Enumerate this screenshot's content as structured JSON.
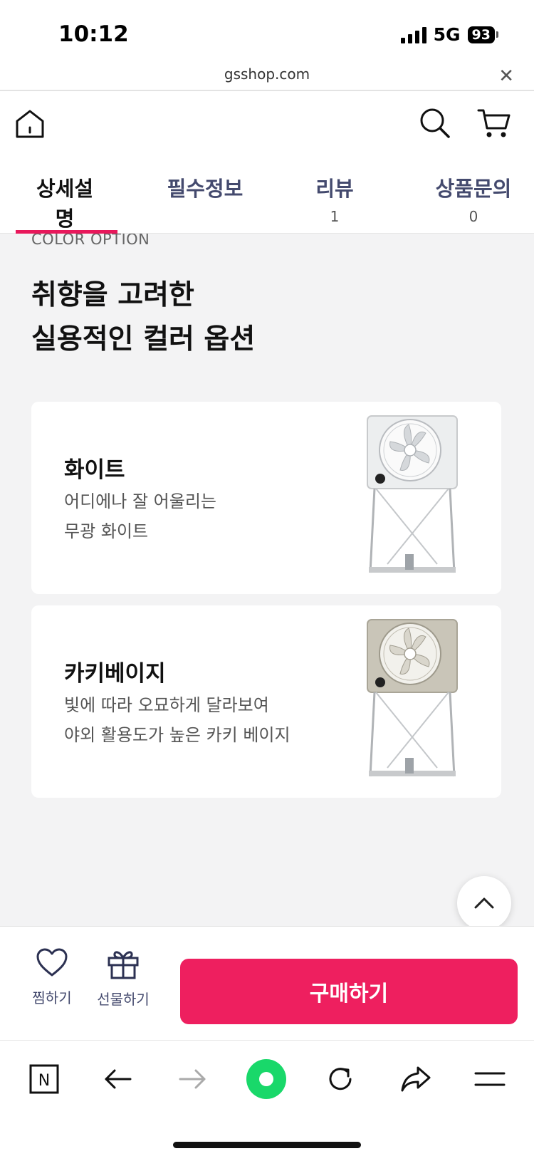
{
  "status_bar": {
    "time": "10:12",
    "network": "5G",
    "battery": "93"
  },
  "browser": {
    "url": "gsshop.com"
  },
  "tabs": [
    {
      "label": "상세설명",
      "count": ""
    },
    {
      "label": "필수정보",
      "count": ""
    },
    {
      "label": "리뷰",
      "count": "1"
    },
    {
      "label": "상품문의",
      "count": "0"
    }
  ],
  "section": {
    "eyebrow": "COLOR OPTION",
    "headline_line1": "취향을 고려한",
    "headline_line2": "실용적인 컬러 옵션"
  },
  "options": [
    {
      "title": "화이트",
      "desc1": "어디에나 잘 어울리는",
      "desc2": "무광 화이트",
      "color": "#e9ebec"
    },
    {
      "title": "카키베이지",
      "desc1": "빛에 따라 오묘하게 달라보여",
      "desc2": "야외 활용도가 높은 카키 베이지",
      "color": "#c9c5b8"
    }
  ],
  "actions": {
    "wish_label": "찜하기",
    "gift_label": "선물하기",
    "buy_label": "구매하기"
  },
  "colors": {
    "accent": "#ee1f5f",
    "tab_text": "#444a6e",
    "background": "#f3f3f4"
  }
}
